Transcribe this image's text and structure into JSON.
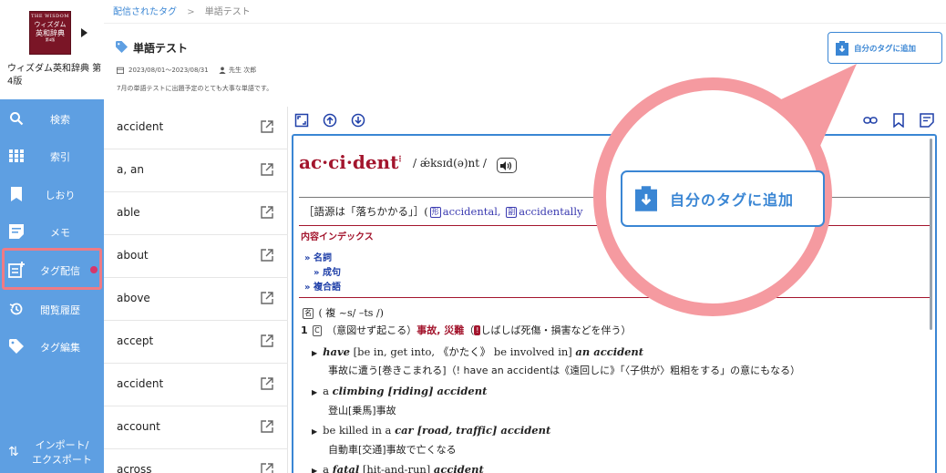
{
  "sidebar": {
    "book": {
      "cover_l1": "THE WISDOM",
      "cover_l2": "ウィズダム",
      "cover_l3": "英和辞典",
      "cover_l4": "第4版",
      "title": "ウィズダム英和辞典 第4版"
    },
    "items": [
      {
        "label": "検索",
        "icon": "search-icon"
      },
      {
        "label": "索引",
        "icon": "grid-icon"
      },
      {
        "label": "しおり",
        "icon": "bookmark-icon"
      },
      {
        "label": "メモ",
        "icon": "memo-icon"
      },
      {
        "label": "タグ配信",
        "icon": "tag-delivery-icon",
        "active": true
      },
      {
        "label": "閲覧履歴",
        "icon": "history-icon"
      },
      {
        "label": "タグ編集",
        "icon": "tag-icon"
      }
    ],
    "import_label_1": "インポート/",
    "import_label_2": "エクスポート"
  },
  "breadcrumb": {
    "parent": "配信されたタグ",
    "separator": ">",
    "current": "単語テスト"
  },
  "tag": {
    "title": "単語テスト",
    "date_range": "2023/08/01〜2023/08/31",
    "author": "先生 次郎",
    "description": "7月の単語テストに出題予定のとても大事な単語です。"
  },
  "add_tag_button": {
    "label": "自分のタグに追加"
  },
  "word_list": [
    "accident",
    "a, an",
    "able",
    "about",
    "above",
    "accept",
    "accident",
    "account",
    "across"
  ],
  "dictionary": {
    "headword": "ac·ci·dent",
    "stress_mark": "⁝",
    "pronunciation": "/ ǽksɪd(ə)nt /",
    "etymology_prefix": "［語源は「落ちかかる」］(",
    "etym_mark_1": "形",
    "etym_rel_1": "accidental,",
    "etym_mark_2": "副",
    "etym_rel_2": "accidentally",
    "index_title": "内容インデックス",
    "index_links": [
      "» 名詞",
      "» 成句",
      "» 複合語"
    ],
    "pos_mark": "名",
    "pos_text": "( 複 ~s/ –ts /)",
    "sense_num": "1",
    "sense_mark": "C",
    "sense_paren": "（意図せず起こる）",
    "sense_red": "事故, 災難",
    "sense_note_mark": "!",
    "sense_note": "しばしば死傷・損害などを伴う）",
    "examples": [
      {
        "en_pre": "",
        "en_b": "have",
        "en_mid": " [be in, get into, 《かたく》 be involved in] ",
        "en_b2": "an accident",
        "ja": "事故に遭う[巻きこまれる]（! have an accidentは《遠回しに》「〈子供が〉粗相をする」の意にもなる）"
      },
      {
        "en_pre": "a ",
        "en_b": "climbing [riding] accident",
        "en_mid": "",
        "en_b2": "",
        "ja": "登山[乗馬]事故"
      },
      {
        "en_pre": "be killed in a ",
        "en_b": "car [road, traffic] accident",
        "en_mid": "",
        "en_b2": "",
        "ja": "自動車[交通]事故で亡くなる"
      },
      {
        "en_pre": "a ",
        "en_b": "fatal",
        "en_mid": " [hit-and-run] ",
        "en_b2": "accident",
        "ja": ""
      }
    ]
  },
  "magnifier": {
    "label": "自分のタグに追加"
  },
  "colors": {
    "sidebar": "#5e9fe2",
    "accent": "#3a86d4",
    "headword": "#a3152d",
    "highlight": "#f59aa0"
  }
}
